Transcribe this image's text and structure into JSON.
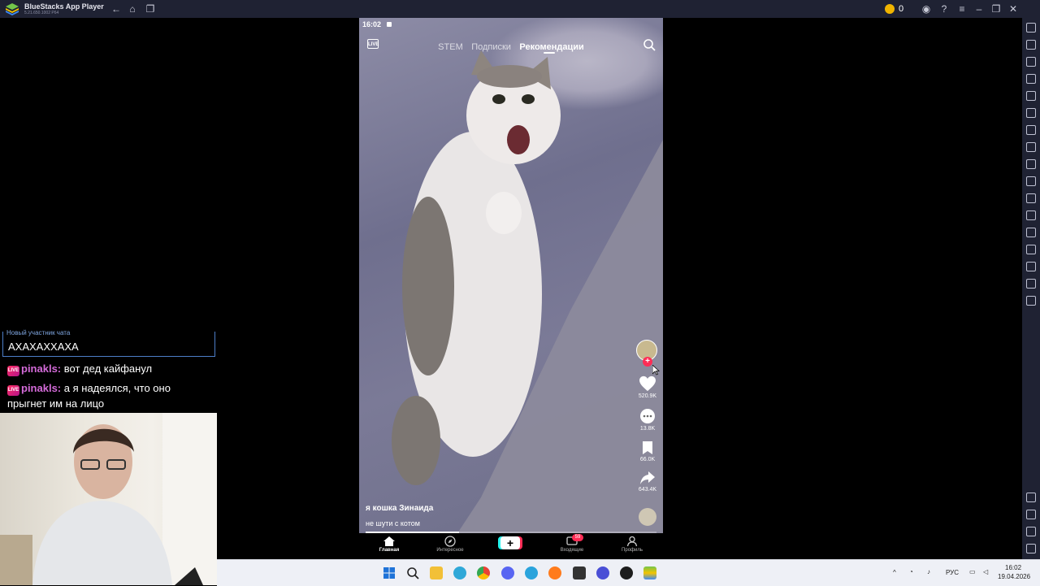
{
  "window": {
    "title": "BlueStacks App Player",
    "version": "5.21.650.1002 P64",
    "coins": "0"
  },
  "phone": {
    "status_time": "16:02",
    "tabs": [
      {
        "label": "STEM",
        "active": false
      },
      {
        "label": "Подписки",
        "active": false
      },
      {
        "label": "Рекомендации",
        "active": true
      }
    ],
    "side": {
      "likes": "520.9K",
      "comments": "13.8K",
      "saves": "66.0K",
      "shares": "643.4K"
    },
    "caption": {
      "user": "я кошка Зинаида",
      "text": "не шути с котом"
    },
    "progress": 0.32,
    "nav": {
      "home": "Главная",
      "discover": "Интересное",
      "inbox": "Входящие",
      "inbox_badge": "59",
      "profile": "Профиль"
    }
  },
  "chat": {
    "new_member_label": "Новый участник чата",
    "new_member_msg": "АХАХАХХАХА",
    "live_badge": "LIVE",
    "messages": [
      {
        "user": "pinakls",
        "text": "вот дед кайфанул"
      },
      {
        "user": "pinakls",
        "text": "а я надеялся, что оно прыгнет им на лицо"
      }
    ]
  },
  "taskbar": {
    "lang": "РУС",
    "time": "16:02",
    "date": "19.04.2026"
  },
  "colors": {
    "accent": "#fe2c55",
    "titlebar": "#1f2233",
    "chat_user": "#d46bd9"
  }
}
